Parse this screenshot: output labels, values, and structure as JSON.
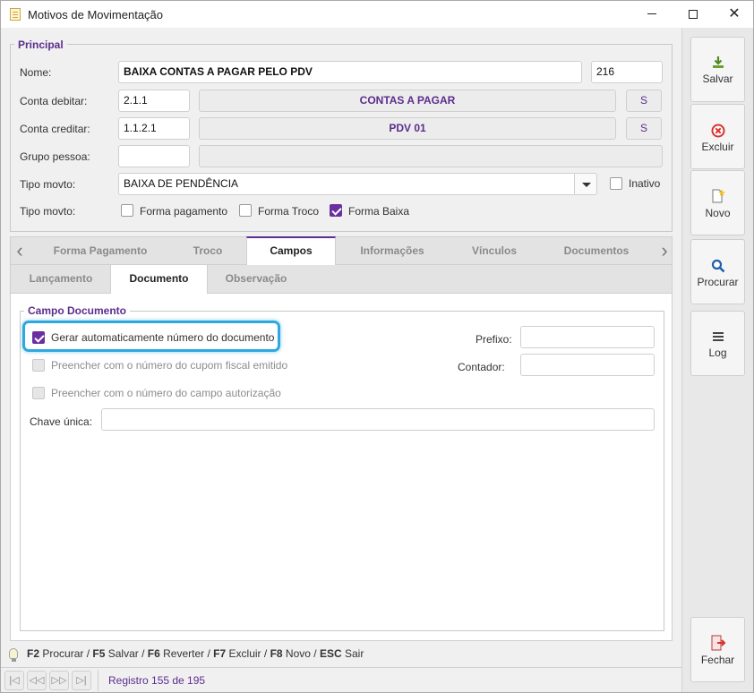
{
  "window": {
    "title": "Motivos de Movimentação",
    "minimize": "—",
    "maximize": "☐",
    "close": "✕"
  },
  "principal": {
    "legend": "Principal",
    "nome_label": "Nome:",
    "nome_value": "BAIXA CONTAS A PAGAR PELO PDV",
    "codigo_value": "216",
    "conta_debitar_label": "Conta debitar:",
    "conta_debitar_code": "2.1.1",
    "conta_debitar_desc": "CONTAS A PAGAR",
    "conta_debitar_btn": "S",
    "conta_creditar_label": "Conta creditar:",
    "conta_creditar_code": "1.1.2.1",
    "conta_creditar_desc": "PDV 01",
    "conta_creditar_btn": "S",
    "grupo_pessoa_label": "Grupo pessoa:",
    "grupo_pessoa_code": "",
    "grupo_pessoa_desc": "",
    "tipo_movto_label": "Tipo movto:",
    "tipo_movto_value": "BAIXA DE PENDÊNCIA",
    "inativo_label": "Inativo",
    "inativo_checked": false,
    "tipo_movto2_label": "Tipo movto:",
    "forma_pagamento_label": "Forma pagamento",
    "forma_pagamento_checked": false,
    "forma_troco_label": "Forma Troco",
    "forma_troco_checked": false,
    "forma_baixa_label": "Forma Baixa",
    "forma_baixa_checked": true
  },
  "tabs": [
    {
      "label": "Forma Pagamento",
      "active": false
    },
    {
      "label": "Troco",
      "active": false
    },
    {
      "label": "Campos",
      "active": true
    },
    {
      "label": "Informações",
      "active": false
    },
    {
      "label": "Vínculos",
      "active": false
    },
    {
      "label": "Documentos",
      "active": false
    }
  ],
  "subtabs": [
    {
      "label": "Lançamento",
      "active": false
    },
    {
      "label": "Documento",
      "active": true
    },
    {
      "label": "Observação",
      "active": false
    }
  ],
  "campo_documento": {
    "legend": "Campo Documento",
    "gerar_label": "Gerar automaticamente número do documento",
    "gerar_checked": true,
    "cupom_label": "Preencher com o número do cupom fiscal emitido",
    "autorizacao_label": "Preencher com o número do campo autorização",
    "prefixo_label": "Prefixo:",
    "prefixo_value": "",
    "contador_label": "Contador:",
    "contador_value": "",
    "chave_label": "Chave única:",
    "chave_value": ""
  },
  "hints": {
    "items": [
      {
        "key": "F2",
        "action": "Procurar"
      },
      {
        "key": "F5",
        "action": "Salvar"
      },
      {
        "key": "F6",
        "action": "Reverter"
      },
      {
        "key": "F7",
        "action": "Excluir"
      },
      {
        "key": "F8",
        "action": "Novo"
      },
      {
        "key": "ESC",
        "action": "Sair"
      }
    ]
  },
  "status": {
    "registro": "Registro 155 de 195"
  },
  "sidebar": {
    "salvar": "Salvar",
    "excluir": "Excluir",
    "novo": "Novo",
    "procurar": "Procurar",
    "log": "Log",
    "fechar": "Fechar"
  },
  "colors": {
    "accent": "#5b2d8e",
    "highlight": "#2ea8e0"
  }
}
